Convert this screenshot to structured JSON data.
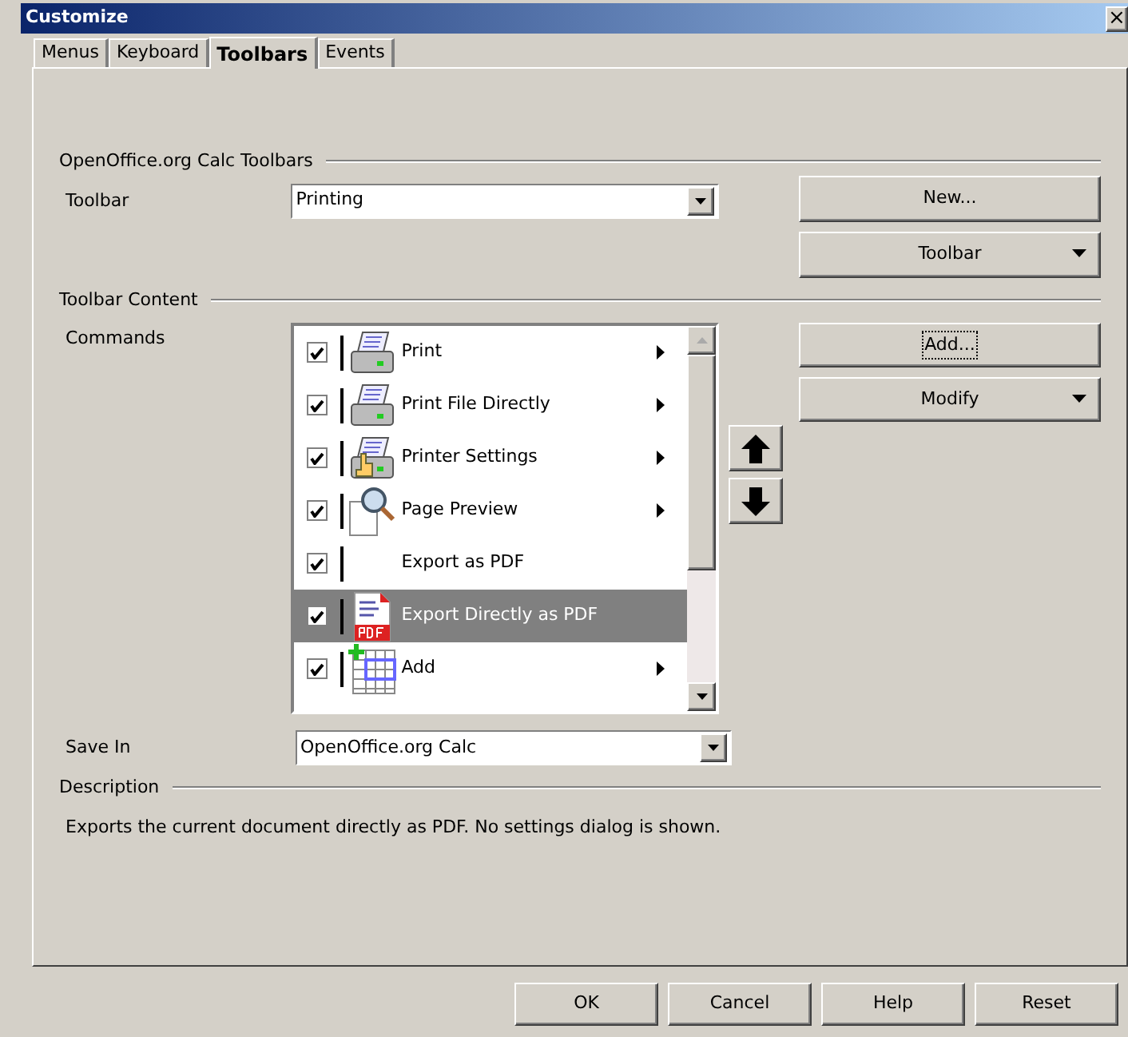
{
  "window": {
    "title": "Customize",
    "close": "×"
  },
  "tabs": [
    {
      "label": "Menus",
      "selected": false
    },
    {
      "label": "Keyboard",
      "selected": false
    },
    {
      "label": "Toolbars",
      "selected": true
    },
    {
      "label": "Events",
      "selected": false
    }
  ],
  "toolbars_group": {
    "title": "OpenOffice.org Calc Toolbars",
    "toolbar_label": "Toolbar",
    "toolbar_value": "Printing",
    "new_button": "New...",
    "toolbar_button": "Toolbar"
  },
  "content_group": {
    "title": "Toolbar Content",
    "commands_label": "Commands",
    "commands": [
      {
        "label": "Print",
        "kind": "printer",
        "checked": true,
        "submenu": true,
        "selected": false
      },
      {
        "label": "Print File Directly",
        "kind": "printer",
        "checked": true,
        "submenu": true,
        "selected": false
      },
      {
        "label": "Printer Settings",
        "kind": "printer-hand",
        "checked": true,
        "submenu": true,
        "selected": false
      },
      {
        "label": "Page Preview",
        "kind": "preview",
        "checked": true,
        "submenu": true,
        "selected": false
      },
      {
        "label": "Export as PDF",
        "kind": "none",
        "checked": true,
        "submenu": false,
        "selected": false
      },
      {
        "label": "Export Directly as PDF",
        "kind": "pdf",
        "checked": true,
        "submenu": false,
        "selected": true
      },
      {
        "label": "Add",
        "kind": "table",
        "checked": true,
        "submenu": true,
        "selected": false
      }
    ],
    "add_button": "Add...",
    "modify_button": "Modify",
    "save_in_label": "Save In",
    "save_in_value": "OpenOffice.org Calc"
  },
  "description": {
    "title": "Description",
    "text": "Exports the current document directly as PDF. No settings dialog is shown."
  },
  "buttons": [
    "OK",
    "Cancel",
    "Help",
    "Reset"
  ]
}
